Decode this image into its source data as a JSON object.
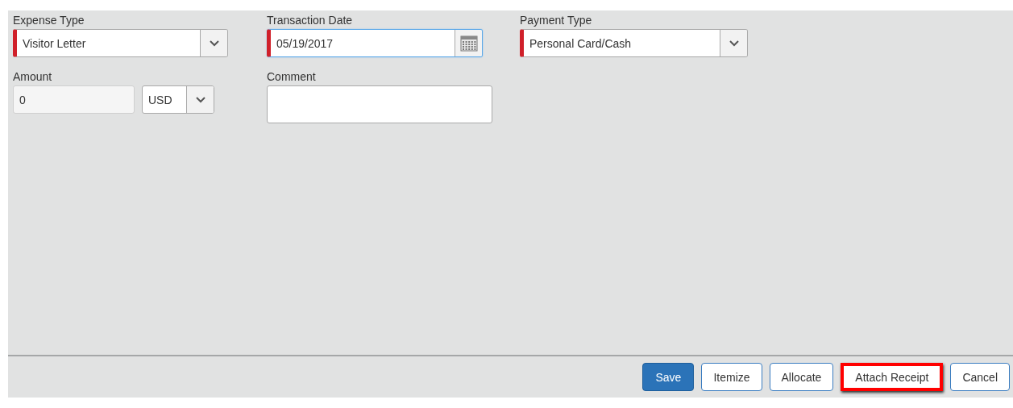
{
  "fields": [
    {
      "kind": "select",
      "label": "Expense Type",
      "value": "Visitor Letter",
      "required": true,
      "focused": false
    },
    {
      "kind": "date",
      "label": "Transaction Date",
      "value": "05/19/2017",
      "required": true,
      "focused": true
    },
    {
      "kind": "select",
      "label": "Payment Type",
      "value": "Personal Card/Cash",
      "required": true,
      "focused": false
    },
    {
      "kind": "amount",
      "label": "Amount",
      "value": "0",
      "currency": "USD",
      "required": false,
      "focused": false
    },
    {
      "kind": "textarea",
      "label": "Comment",
      "required": false,
      "focused": false
    }
  ],
  "buttons": [
    {
      "label": "Save",
      "kind": "primary",
      "highlighted": false
    },
    {
      "label": "Itemize",
      "kind": "secondary",
      "highlighted": false
    },
    {
      "label": "Allocate",
      "kind": "secondary",
      "highlighted": false
    },
    {
      "label": "Attach Receipt",
      "kind": "secondary",
      "highlighted": true
    },
    {
      "label": "Cancel",
      "kind": "secondary",
      "highlighted": false
    }
  ]
}
